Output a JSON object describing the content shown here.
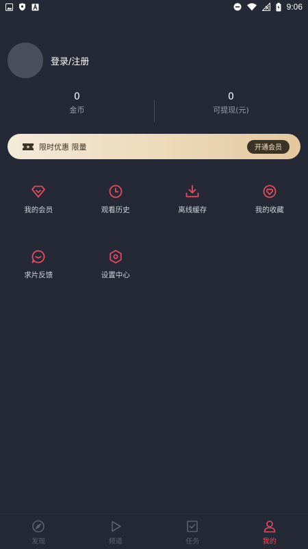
{
  "status_bar": {
    "time": "9:06"
  },
  "profile": {
    "login_text": "登录/注册"
  },
  "stats": [
    {
      "value": "0",
      "label": "金币"
    },
    {
      "value": "0",
      "label": "可提现(元)"
    }
  ],
  "vip_banner": {
    "text": "限时优惠 限量",
    "button": "开通会员"
  },
  "menu": [
    {
      "label": "我的会员",
      "icon": "diamond-icon"
    },
    {
      "label": "观看历史",
      "icon": "clock-icon"
    },
    {
      "label": "离线缓存",
      "icon": "download-icon"
    },
    {
      "label": "我的收藏",
      "icon": "heart-icon"
    },
    {
      "label": "求片反馈",
      "icon": "chat-bubble-icon"
    },
    {
      "label": "设置中心",
      "icon": "hexagon-settings-icon"
    }
  ],
  "bottom_nav": [
    {
      "label": "发现",
      "icon": "compass-icon"
    },
    {
      "label": "频道",
      "icon": "play-icon"
    },
    {
      "label": "任务",
      "icon": "task-icon"
    },
    {
      "label": "我的",
      "icon": "user-icon",
      "active": true
    }
  ],
  "colors": {
    "accent": "#e64b5f",
    "background": "#252936",
    "vip_gold": "#ecd9b8",
    "inactive": "#5c6070"
  }
}
